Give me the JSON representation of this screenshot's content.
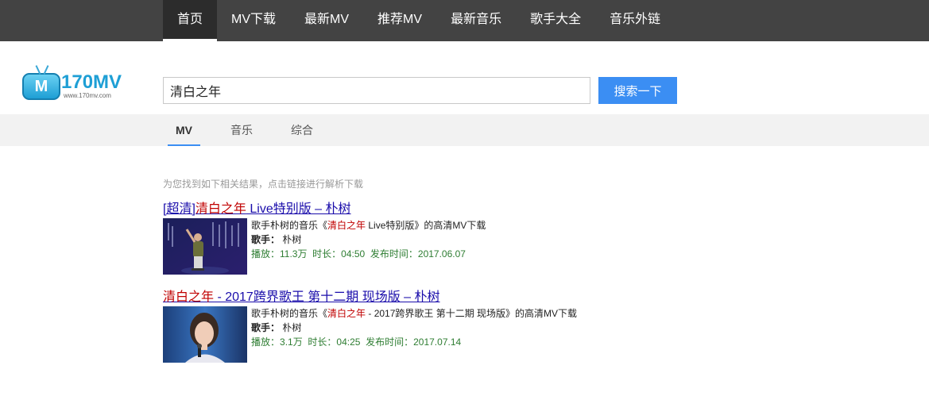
{
  "nav": {
    "items": [
      {
        "label": "首页",
        "active": true
      },
      {
        "label": "MV下载",
        "active": false
      },
      {
        "label": "最新MV",
        "active": false
      },
      {
        "label": "推荐MV",
        "active": false
      },
      {
        "label": "最新音乐",
        "active": false
      },
      {
        "label": "歌手大全",
        "active": false
      },
      {
        "label": "音乐外链",
        "active": false
      }
    ]
  },
  "logo": {
    "mark": "M",
    "text": "170MV",
    "sub": "www.170mv.com"
  },
  "search": {
    "value": "清白之年",
    "button_label": "搜索一下"
  },
  "tabs": [
    {
      "label": "MV",
      "active": true
    },
    {
      "label": "音乐",
      "active": false
    },
    {
      "label": "综合",
      "active": false
    }
  ],
  "hint": "为您找到如下相关结果，点击链接进行解析下载",
  "results": [
    {
      "title_prefix": "[超清]",
      "title_highlight": "清白之年",
      "title_rest": " Live特别版 – 朴树",
      "desc_before": "歌手朴树的音乐《",
      "desc_highlight": "清白之年",
      "desc_after": " Live特别版》的高清MV下载",
      "singer_label": "歌手：",
      "singer": "朴树",
      "plays_label": "播放：",
      "plays": "11.3万",
      "duration_label": "时长：",
      "duration": "04:50",
      "date_label": "发布时间：",
      "date": "2017.06.07"
    },
    {
      "title_prefix": "",
      "title_highlight": "清白之年",
      "title_rest": " - 2017跨界歌王 第十二期 现场版 – 朴树",
      "desc_before": "歌手朴树的音乐《",
      "desc_highlight": "清白之年",
      "desc_after": " - 2017跨界歌王 第十二期 现场版》的高清MV下载",
      "singer_label": "歌手：",
      "singer": "朴树",
      "plays_label": "播放：",
      "plays": "3.1万",
      "duration_label": "时长：",
      "duration": "04:25",
      "date_label": "发布时间：",
      "date": "2017.07.14"
    }
  ],
  "colors": {
    "nav_bg": "#434343",
    "accent": "#3b8ef3",
    "highlight": "#c00000",
    "link": "#1a0dab",
    "meta": "#2e7d32"
  }
}
